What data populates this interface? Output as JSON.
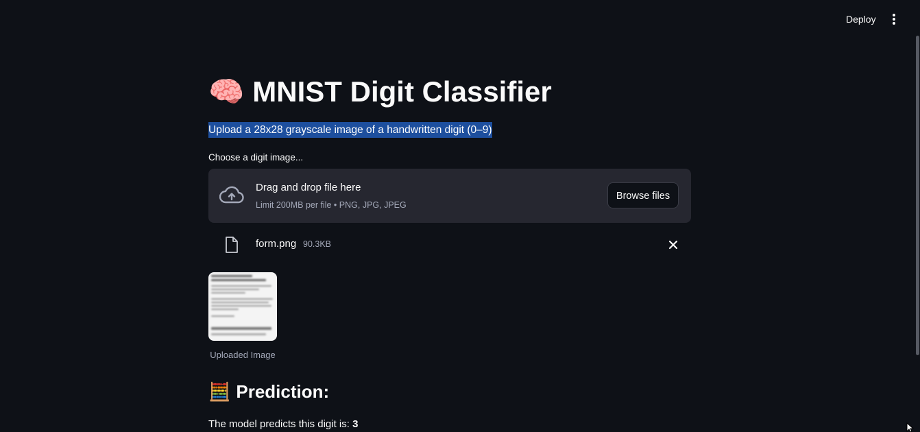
{
  "header": {
    "deploy_label": "Deploy",
    "menu_icon": "more-vertical-icon"
  },
  "main": {
    "title_emoji": "🧠",
    "title": "MNIST Digit Classifier",
    "subtitle": "Upload a 28x28 grayscale image of a handwritten digit (0–9)",
    "uploader": {
      "label": "Choose a digit image...",
      "drop_title": "Drag and drop file here",
      "limit_text": "Limit 200MB per file • PNG, JPG, JPEG",
      "browse_label": "Browse files",
      "cloud_icon": "cloud-upload-icon"
    },
    "file": {
      "name": "form.png",
      "size": "90.3KB",
      "icon": "file-icon",
      "remove_icon": "close-icon"
    },
    "image_caption": "Uploaded Image",
    "prediction": {
      "emoji": "🧮",
      "heading": "Prediction:",
      "text_prefix": "The model predicts this digit is: ",
      "digit": "3"
    }
  },
  "colors": {
    "background": "#0e1117",
    "panel": "#262730",
    "selection_highlight": "#1d4f9e",
    "muted_text": "#a3a8b8"
  }
}
